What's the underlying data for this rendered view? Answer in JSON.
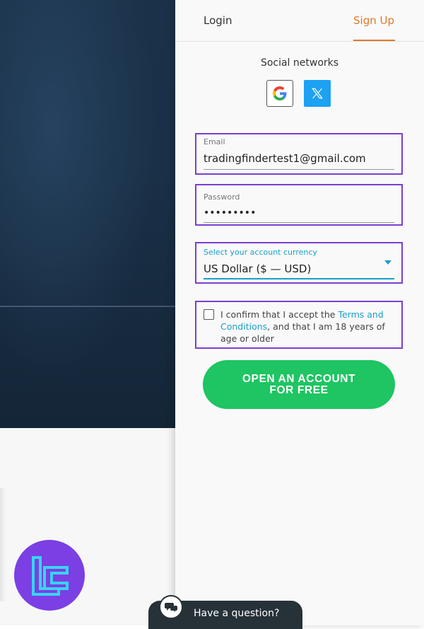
{
  "tabs": {
    "login": "Login",
    "signup": "Sign Up",
    "active": "signup"
  },
  "social": {
    "title": "Social networks",
    "providers": [
      {
        "name": "google-icon"
      },
      {
        "name": "x-icon"
      }
    ]
  },
  "form": {
    "email": {
      "label": "Email",
      "value": "tradingfindertest1@gmail.com"
    },
    "password": {
      "label": "Password",
      "value": "•••••••••"
    },
    "currency": {
      "label": "Select your account currency",
      "value": "US Dollar ($ — USD)"
    },
    "terms": {
      "text_before": "I confirm that I accept the ",
      "link": "Terms and Conditions",
      "text_after": ", and that I am 18 years of age or older",
      "checked": false
    },
    "submit": {
      "line1": "OPEN AN ACCOUNT",
      "line2": "FOR FREE"
    }
  },
  "help": {
    "label": "Have a question?"
  },
  "colors": {
    "accent_orange": "#e07a2c",
    "highlight_purple": "#7b3fd1",
    "link_blue": "#1a9fc9",
    "cta_green": "#1ec562",
    "logo_purple": "#7b3fe4"
  }
}
